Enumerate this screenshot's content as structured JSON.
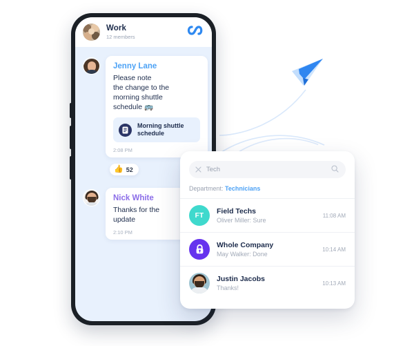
{
  "phone": {
    "header": {
      "title": "Work",
      "members": "12 members",
      "avatar_icon": "group-photo-avatar",
      "logo_icon": "infinity-logo-icon",
      "logo_color": "#2f89f0"
    },
    "messages": [
      {
        "sender": "Jenny Lane",
        "sender_color": "#4da2f5",
        "avatar_icon": "jenny-lane-avatar",
        "text": "Please note\nthe change to the\nmorning shuttle\nschedule 🚌",
        "attachment": {
          "name": "Morning shuttle\nschedule",
          "icon": "document-icon"
        },
        "time": "2:08 PM",
        "reaction": {
          "emoji": "👍",
          "count": "52"
        }
      },
      {
        "sender": "Nick White",
        "sender_color": "#8b6de8",
        "avatar_icon": "nick-white-avatar",
        "text": "Thanks for the\nupdate",
        "time": "2:10 PM"
      }
    ]
  },
  "search_panel": {
    "search": {
      "value": "Tech",
      "placeholder": "Tech",
      "clear_icon": "close-icon",
      "search_icon": "search-icon"
    },
    "filter": {
      "label": "Department:",
      "value": "Technicians",
      "value_color": "#4da2f5"
    },
    "results": [
      {
        "name": "Field Techs",
        "preview": "Oliver Miller: Sure",
        "time": "11:08 AM",
        "avatar_type": "initials",
        "initials": "FT",
        "avatar_color": "#3fd9cd"
      },
      {
        "name": "Whole Company",
        "preview": "May Walker: Done",
        "time": "10:14 AM",
        "avatar_type": "lock",
        "avatar_icon": "lock-icon",
        "avatar_color": "#6633ee"
      },
      {
        "name": "Justin Jacobs",
        "preview": "Thanks!",
        "time": "10:13 AM",
        "avatar_type": "photo",
        "avatar_icon": "justin-jacobs-avatar"
      }
    ]
  },
  "decor": {
    "paper_plane_icon": "paper-plane-icon",
    "plane_color_light": "#bfdbfc",
    "plane_color_dark": "#2f7fe8",
    "arc_color": "#d7e7fb"
  }
}
